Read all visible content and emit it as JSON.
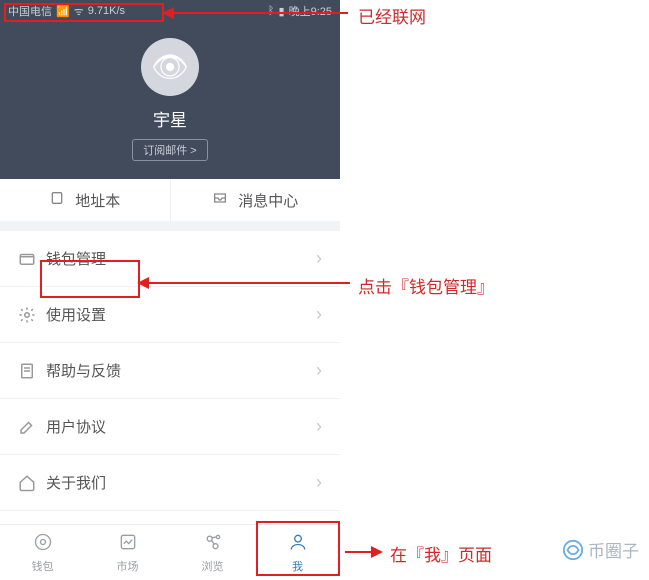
{
  "statusBar": {
    "carrier": "中国电信",
    "netSpeed": "9.71K/s",
    "timeText": "晚上9:25"
  },
  "profile": {
    "username": "宇星",
    "subscribeLabel": "订阅邮件 >"
  },
  "topActions": {
    "addressBook": "地址本",
    "messageCenter": "消息中心"
  },
  "menu": {
    "walletManage": "钱包管理",
    "usageSettings": "使用设置",
    "helpFeedback": "帮助与反馈",
    "userAgreement": "用户协议",
    "aboutUs": "关于我们"
  },
  "nav": {
    "wallet": "钱包",
    "market": "市场",
    "browse": "浏览",
    "me": "我"
  },
  "annotations": {
    "online": "已经联网",
    "clickWallet": "点击『钱包管理』",
    "onMePage": "在『我』页面",
    "watermark": "币圈子"
  }
}
